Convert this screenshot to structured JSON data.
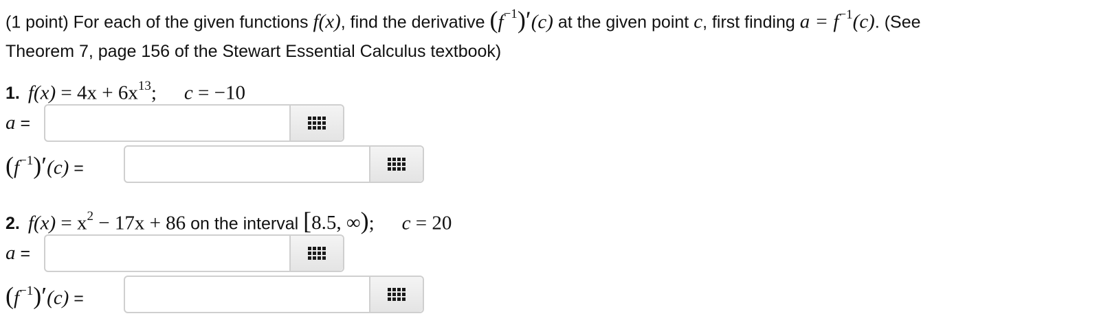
{
  "intro": {
    "t1": "(1 point) For each of the given functions ",
    "fx": "f(x)",
    "t2": ", find the derivative ",
    "deriv_f": "f",
    "deriv_exp": "−1",
    "deriv_c": "(c)",
    "t3": " at the given point ",
    "c": "c",
    "t4": ", first finding ",
    "a_eq": "a = f",
    "a_exp": "−1",
    "a_c": "(c)",
    "t5": ". (See",
    "line2": "Theorem 7, page 156 of the Stewart Essential Calculus textbook)"
  },
  "problems": [
    {
      "number": "1.",
      "fx": "f(x)",
      "eq": " = 4x + 6x",
      "exp": "13",
      "semi": ";",
      "c_label": "c",
      "c_value": " = −10",
      "a_label": "a",
      "a_eq": " =",
      "a_value": "",
      "deriv_f": "f",
      "deriv_exp": "−1",
      "deriv_c": "(c)",
      "deriv_eq": " =",
      "deriv_value": ""
    },
    {
      "number": "2.",
      "fx": "f(x)",
      "eq": " = x",
      "exp": "2",
      "eq2": " − 17x + 86",
      "interval_text": " on the interval ",
      "interval": "8.5, ∞",
      "semi": ";",
      "c_label": "c",
      "c_value": " = 20",
      "a_label": "a",
      "a_eq": " =",
      "a_value": "",
      "deriv_f": "f",
      "deriv_exp": "−1",
      "deriv_c": "(c)",
      "deriv_eq": " =",
      "deriv_value": ""
    }
  ],
  "icons": {
    "equation_editor": "grid-icon"
  },
  "colors": {
    "field_border": "#cfcfcf",
    "button_bg": "#e8e8e8"
  }
}
